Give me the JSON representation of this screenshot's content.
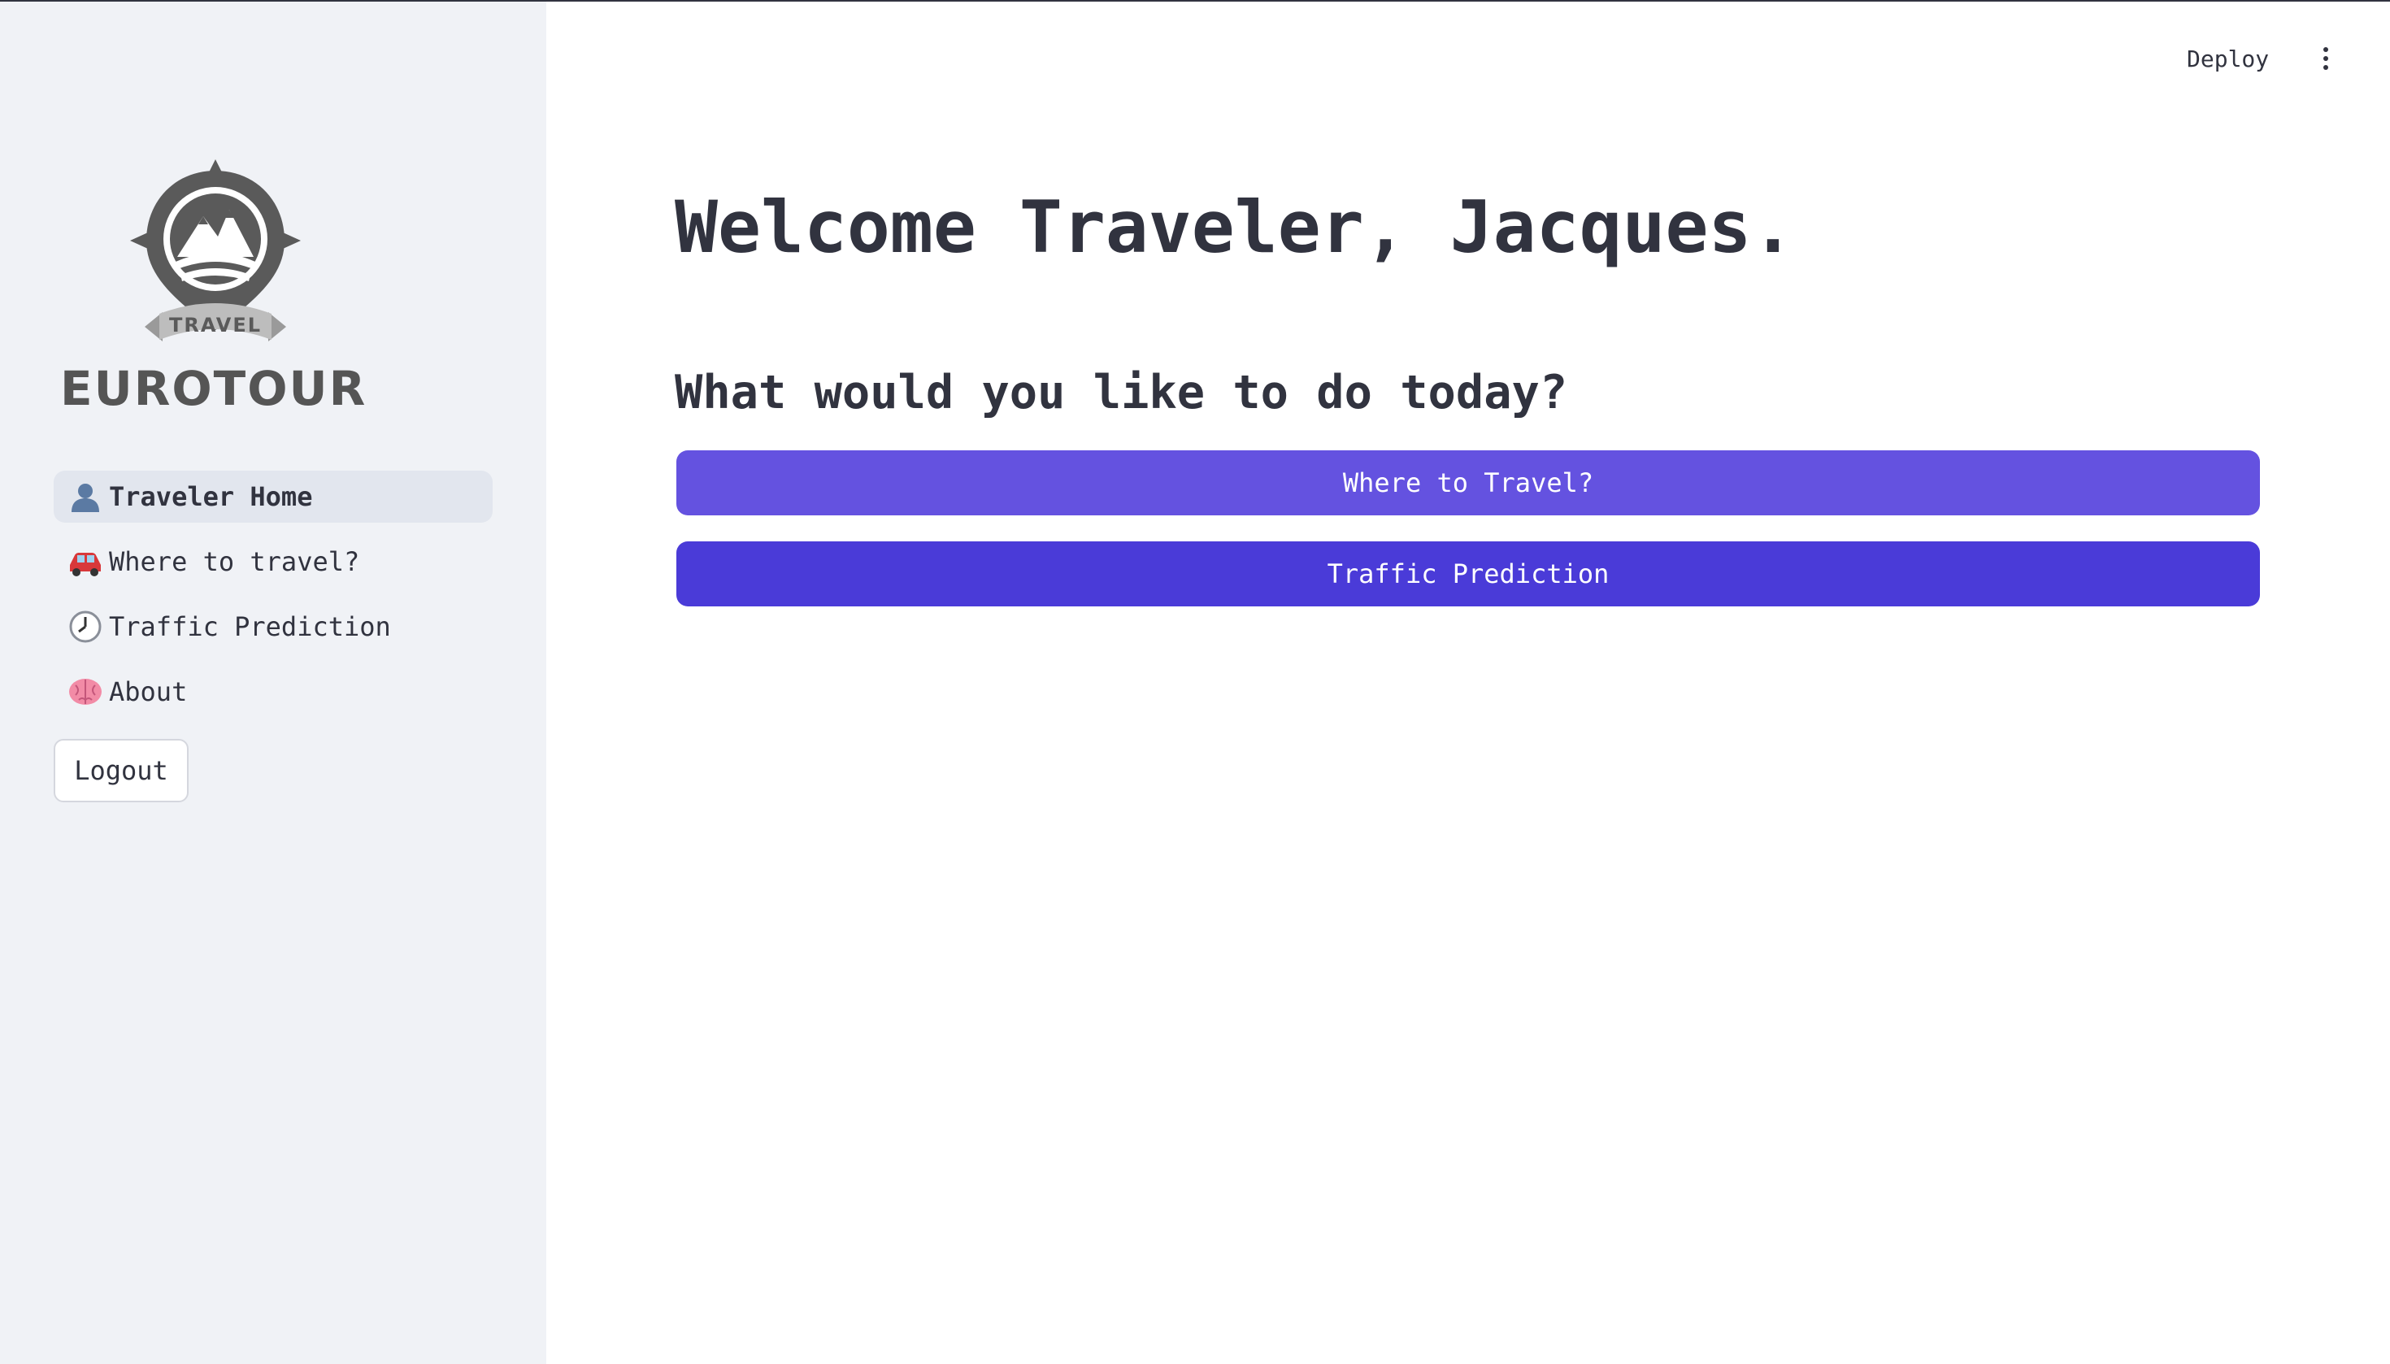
{
  "sidebar": {
    "logo": {
      "badge_text": "TRAVEL",
      "brand": "EUROTOUR"
    },
    "nav": [
      {
        "icon": "bust-silhouette-icon",
        "label": "Traveler Home",
        "active": true
      },
      {
        "icon": "red-car-icon",
        "label": "Where to travel?",
        "active": false
      },
      {
        "icon": "clock-icon",
        "label": "Traffic Prediction",
        "active": false
      },
      {
        "icon": "brain-icon",
        "label": "About",
        "active": false
      }
    ],
    "logout_label": "Logout"
  },
  "header": {
    "deploy_label": "Deploy",
    "menu_icon": "kebab-menu-icon"
  },
  "main": {
    "title": "Welcome Traveler, Jacques.",
    "subtitle": "What would you like to do today?",
    "buttons": [
      {
        "label": "Where to Travel?",
        "color": "#6452e0"
      },
      {
        "label": "Traffic Prediction",
        "color": "#4a3bd8"
      }
    ]
  },
  "colors": {
    "sidebar_bg": "#f0f2f6",
    "active_nav_bg": "#e2e6ee",
    "text": "#31333f",
    "accent": "#6452e0"
  }
}
